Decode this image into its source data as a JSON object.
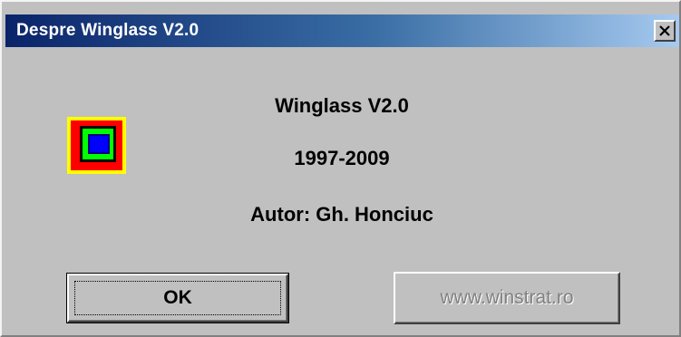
{
  "window": {
    "title": "Despre Winglass V2.0",
    "close_glyph": "✕",
    "close_icon": "close-icon"
  },
  "app_icon": {
    "name": "winglass-logo-icon",
    "colors": [
      "#ffff00",
      "#ff0000",
      "#000000",
      "#00ff00",
      "#000080",
      "#0000ff"
    ]
  },
  "info": {
    "name": "Winglass V2.0",
    "years": "1997-2009",
    "author": "Autor: Gh. Honciuc"
  },
  "buttons": {
    "ok_label": "OK",
    "website_label": "www.winstrat.ro",
    "website_state": "disabled"
  },
  "colors": {
    "dialog_bg": "#c0c0c0",
    "titlebar_start": "#0a246a",
    "titlebar_end": "#a6caf0",
    "disabled_text": "#808080"
  }
}
